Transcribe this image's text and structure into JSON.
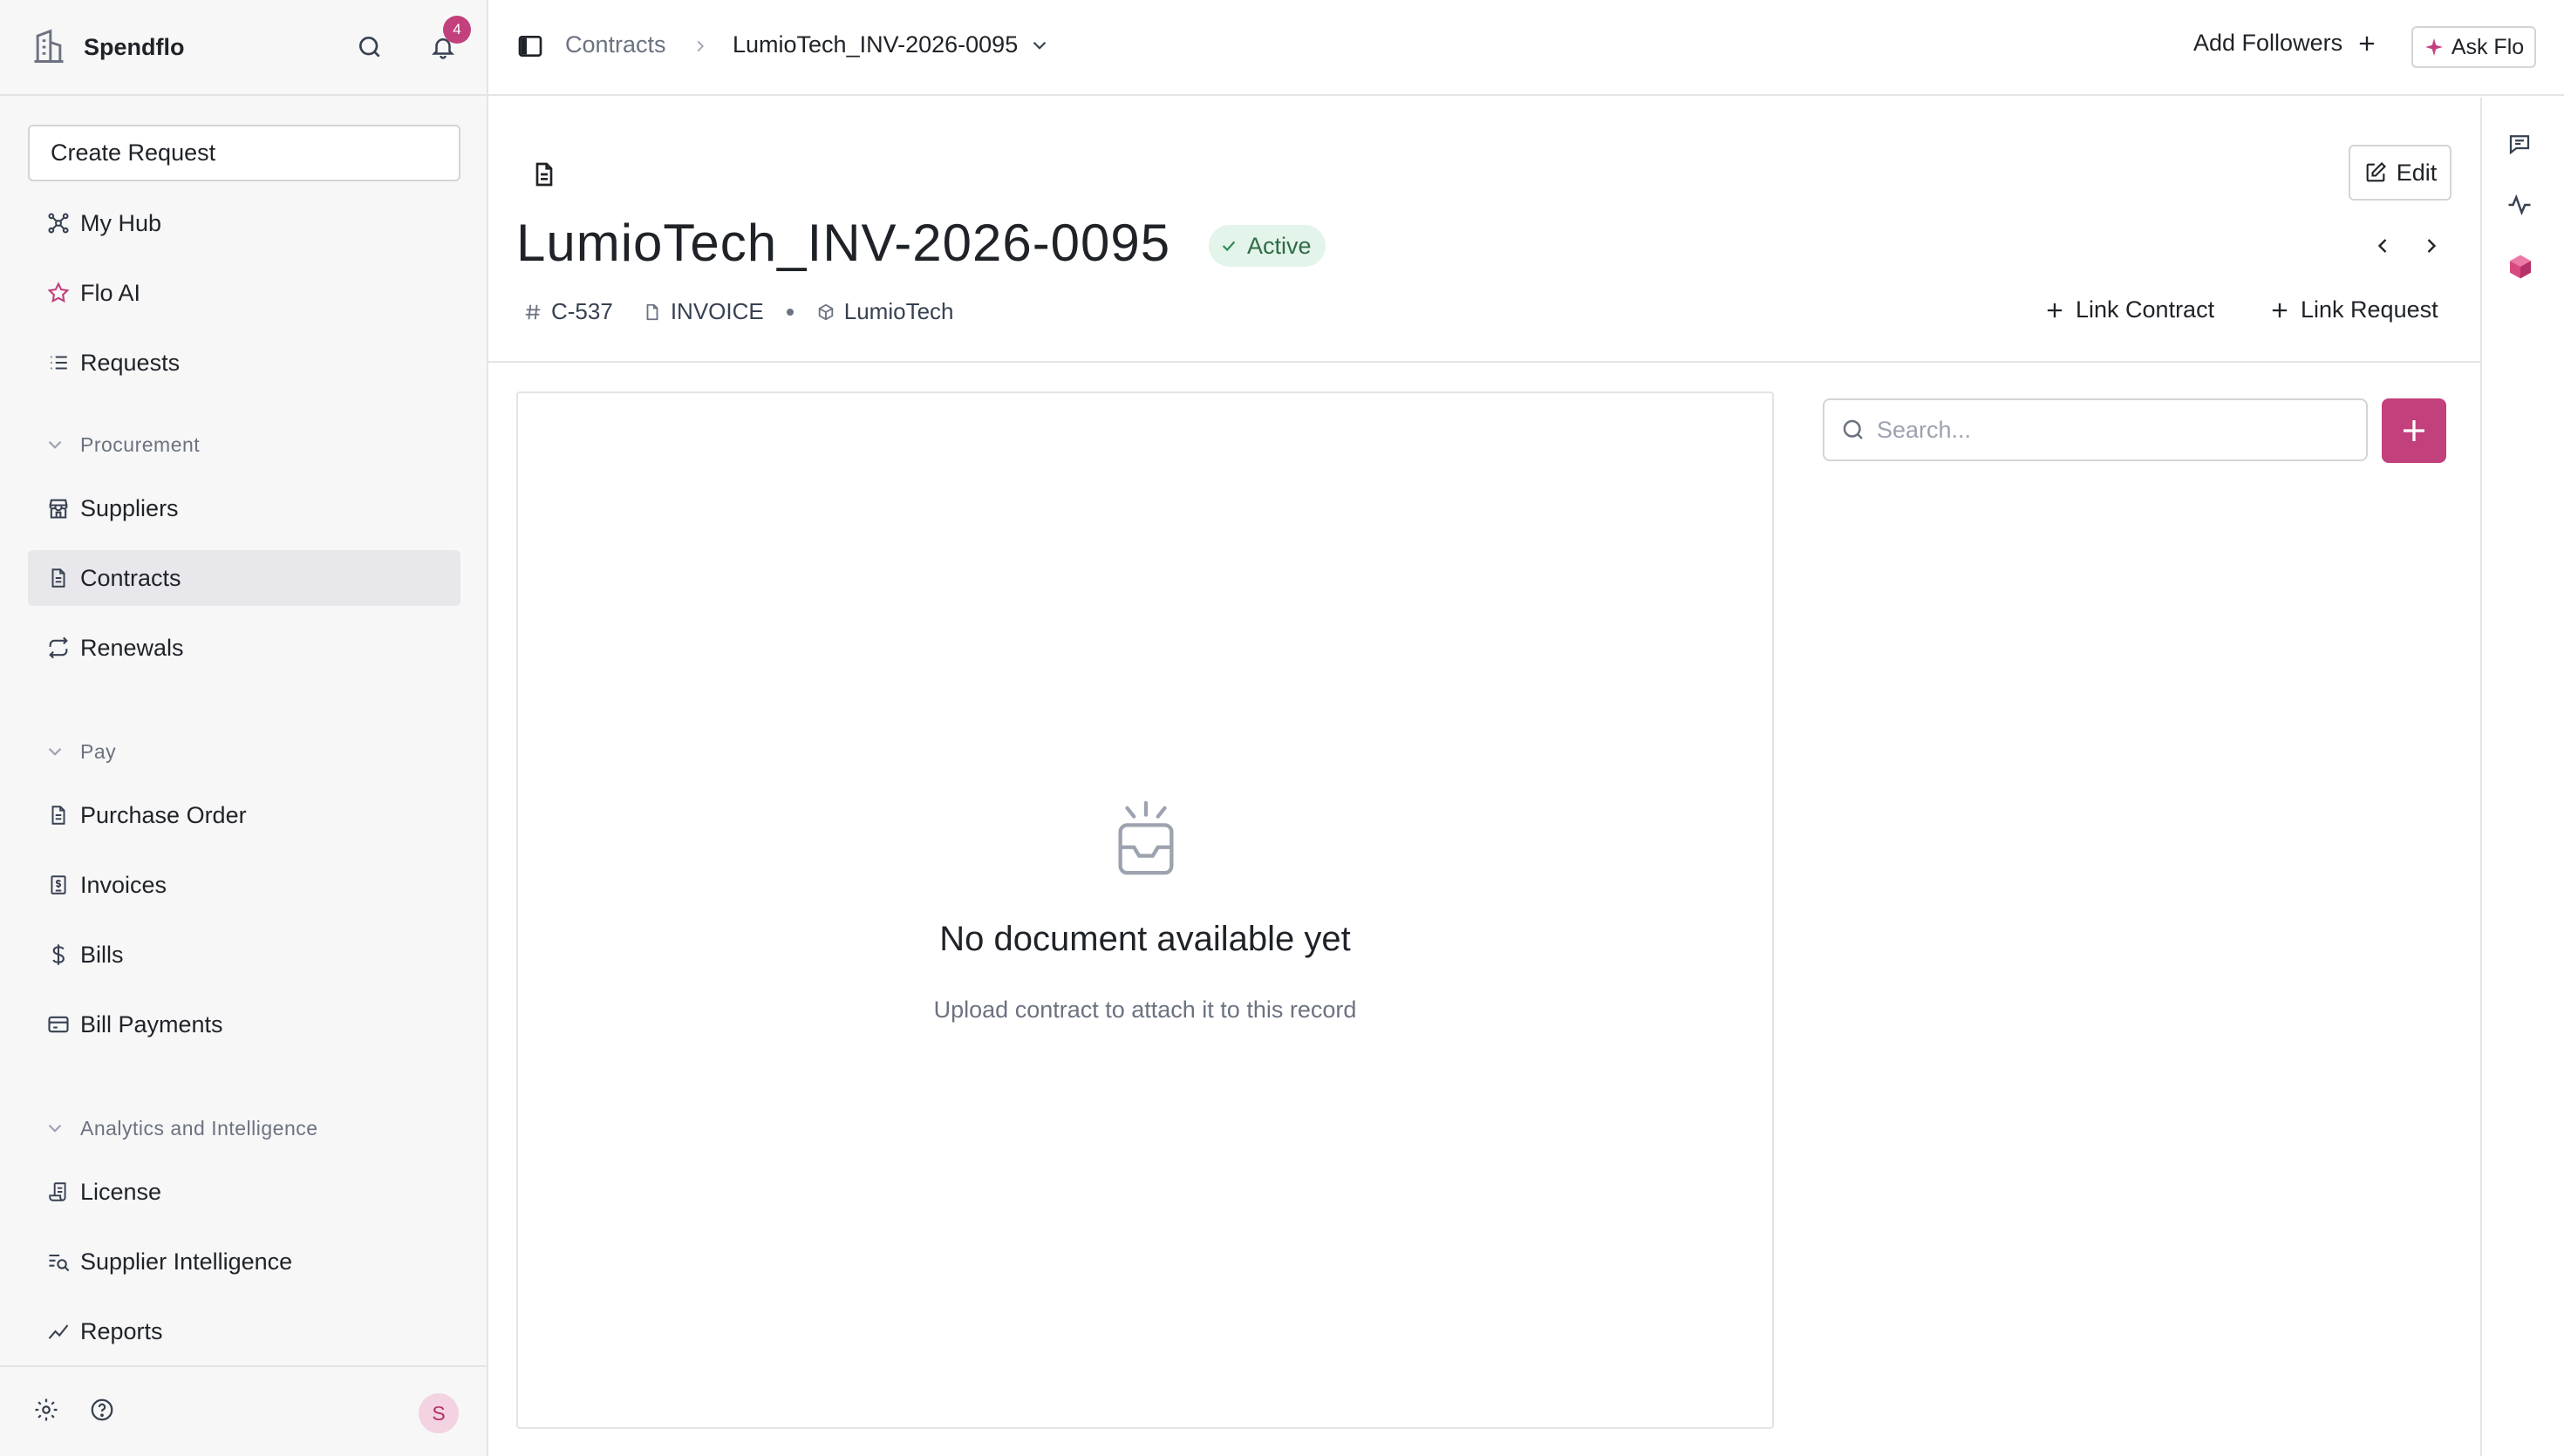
{
  "brand": {
    "name": "Spendflo"
  },
  "header": {
    "notification_count": "4",
    "breadcrumb": {
      "root": "Contracts",
      "current": "LumioTech_INV-2026-0095"
    },
    "add_followers": "Add Followers",
    "ask_flo": "Ask Flo"
  },
  "sidebar": {
    "create_request": "Create Request",
    "top_items": [
      {
        "label": "My Hub",
        "icon": "hub-icon"
      },
      {
        "label": "Flo AI",
        "icon": "star-icon"
      },
      {
        "label": "Requests",
        "icon": "list-icon"
      }
    ],
    "sections": [
      {
        "title": "Procurement",
        "items": [
          {
            "label": "Suppliers",
            "icon": "store-icon"
          },
          {
            "label": "Contracts",
            "icon": "document-icon",
            "active": true
          },
          {
            "label": "Renewals",
            "icon": "repeat-icon"
          }
        ]
      },
      {
        "title": "Pay",
        "items": [
          {
            "label": "Purchase Order",
            "icon": "document-icon"
          },
          {
            "label": "Invoices",
            "icon": "receipt-icon"
          },
          {
            "label": "Bills",
            "icon": "dollar-icon"
          },
          {
            "label": "Bill Payments",
            "icon": "card-icon"
          }
        ]
      },
      {
        "title": "Analytics and Intelligence",
        "items": [
          {
            "label": "License",
            "icon": "license-icon"
          },
          {
            "label": "Supplier Intelligence",
            "icon": "search-list-icon"
          },
          {
            "label": "Reports",
            "icon": "trend-icon"
          }
        ]
      }
    ],
    "user_initial": "S"
  },
  "record": {
    "title": "LumioTech_INV-2026-0095",
    "status": "Active",
    "id": "C-537",
    "type": "INVOICE",
    "supplier": "LumioTech",
    "edit_label": "Edit",
    "link_contract": "Link Contract",
    "link_request": "Link Request"
  },
  "viewer": {
    "empty_title": "No document available yet",
    "empty_subtitle": "Upload contract to attach it to this record"
  },
  "search": {
    "placeholder": "Search..."
  },
  "colors": {
    "accent": "#c2407b",
    "active_badge_bg": "#e3f4ea",
    "active_badge_text": "#2f6b47",
    "sidebar_bg": "#f7f7f8"
  }
}
